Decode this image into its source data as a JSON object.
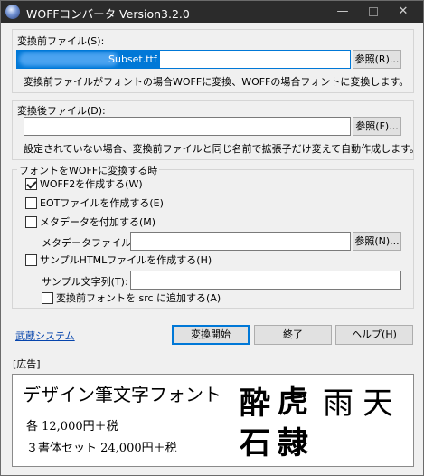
{
  "window": {
    "title": "WOFFコンバータ Version3.2.0",
    "minimize": "—",
    "close": "✕"
  },
  "source": {
    "label": "変換前ファイル(S):",
    "value": "Subset.ttf",
    "browse_label": "参照(R)...",
    "hint": "変換前ファイルがフォントの場合WOFFに変換、WOFFの場合フォントに変換します。"
  },
  "output": {
    "label": "変換後ファイル(D):",
    "value": "",
    "browse_label": "参照(F)...",
    "hint": "設定されていない場合、変換前ファイルと同じ名前で拡張子だけ変えて自動作成します。"
  },
  "options": {
    "group_label": "フォントをWOFFに変換する時",
    "woff2": {
      "label": "WOFF2を作成する(W)",
      "checked": true
    },
    "eot": {
      "label": "EOTファイルを作成する(E)",
      "checked": false
    },
    "metadata": {
      "label": "メタデータを付加する(M)",
      "checked": false
    },
    "metadata_file": {
      "label": "メタデータファイル(I):",
      "value": "",
      "browse_label": "参照(N)..."
    },
    "sample_html": {
      "label": "サンプルHTMLファイルを作成する(H)",
      "checked": false
    },
    "sample_text": {
      "label": "サンプル文字列(T):",
      "value": ""
    },
    "add_src": {
      "label": "変換前フォントを src に追加する(A)",
      "checked": false
    }
  },
  "footer": {
    "vendor_link": "武蔵システム",
    "convert_label": "変換開始",
    "exit_label": "終了",
    "help_label": "ヘルプ(H)"
  },
  "ad": {
    "section_label": "[広告]",
    "title": "デザイン筆文字フォント",
    "price_each": "各 12,000円＋税",
    "price_set": "３書体セット 24,000円＋税",
    "sample_chars": [
      "酔",
      "虎",
      "雨",
      "天",
      "石",
      "隷"
    ]
  }
}
